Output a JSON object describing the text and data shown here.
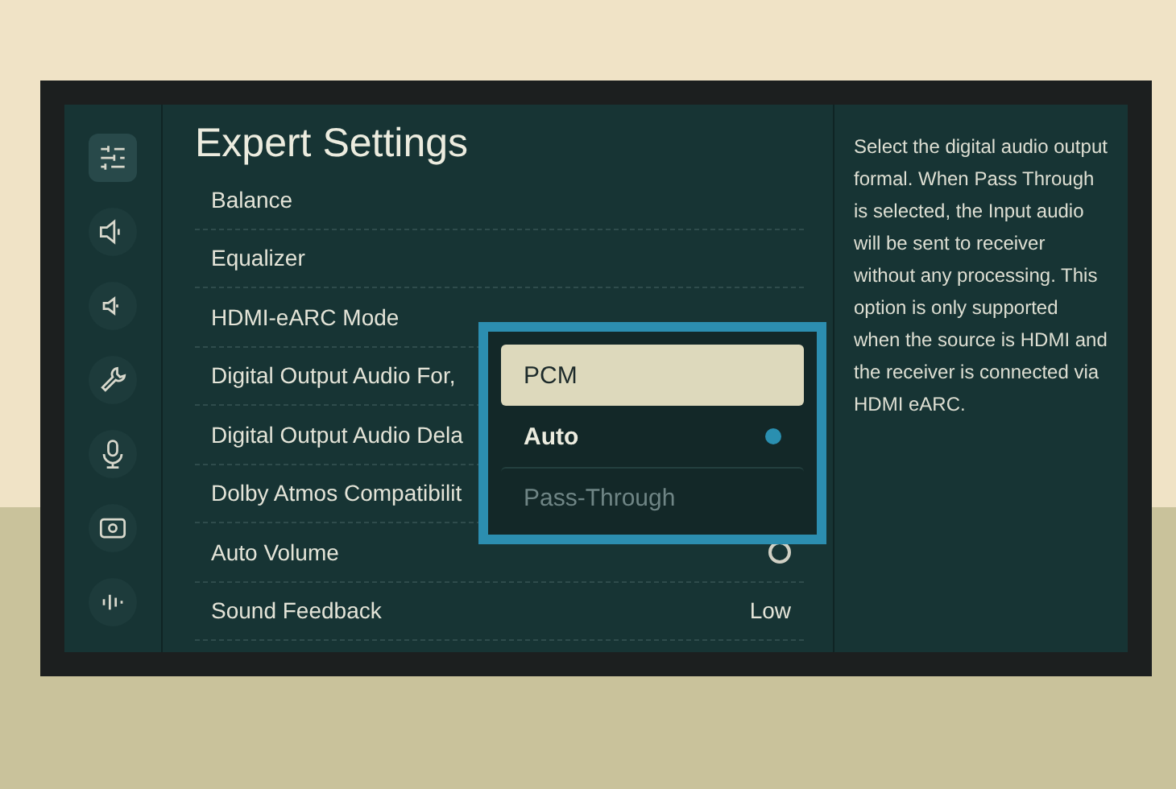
{
  "sidebar": {
    "items": [
      {
        "kind": "sliders",
        "selected": true
      },
      {
        "kind": "speaker",
        "selected": false
      },
      {
        "kind": "speaker-small",
        "selected": false
      },
      {
        "kind": "wrench",
        "selected": false
      },
      {
        "kind": "microphone",
        "selected": false
      },
      {
        "kind": "camera",
        "selected": false
      },
      {
        "kind": "equalizer",
        "selected": false
      }
    ]
  },
  "title": "Expert Settings",
  "settings": [
    {
      "label": "Balance"
    },
    {
      "label": "Equalizer"
    },
    {
      "label": "HDMI-eARC Mode"
    },
    {
      "label": "Digital Output Audio For,"
    },
    {
      "label": "Digital Output Audio Dela"
    },
    {
      "label": "Dolby Atmos Compatibilit"
    },
    {
      "label": "Auto Volume",
      "kind": "toggle",
      "on": false
    },
    {
      "label": "Sound Feedback",
      "kind": "value",
      "value": "Low"
    }
  ],
  "popup": {
    "options": [
      {
        "label": "PCM",
        "selected": true,
        "checked": false,
        "disabled": false
      },
      {
        "label": "Auto",
        "selected": false,
        "checked": true,
        "disabled": false
      },
      {
        "label": "Pass-Through",
        "selected": false,
        "checked": false,
        "disabled": true
      }
    ]
  },
  "help": "Select the digital audio output formal. When Pass Through is selected, the Input audio will be sent to receiver without any processing. This option is only supported when the source is HDMI and the receiver is connected via HDMI eARC."
}
